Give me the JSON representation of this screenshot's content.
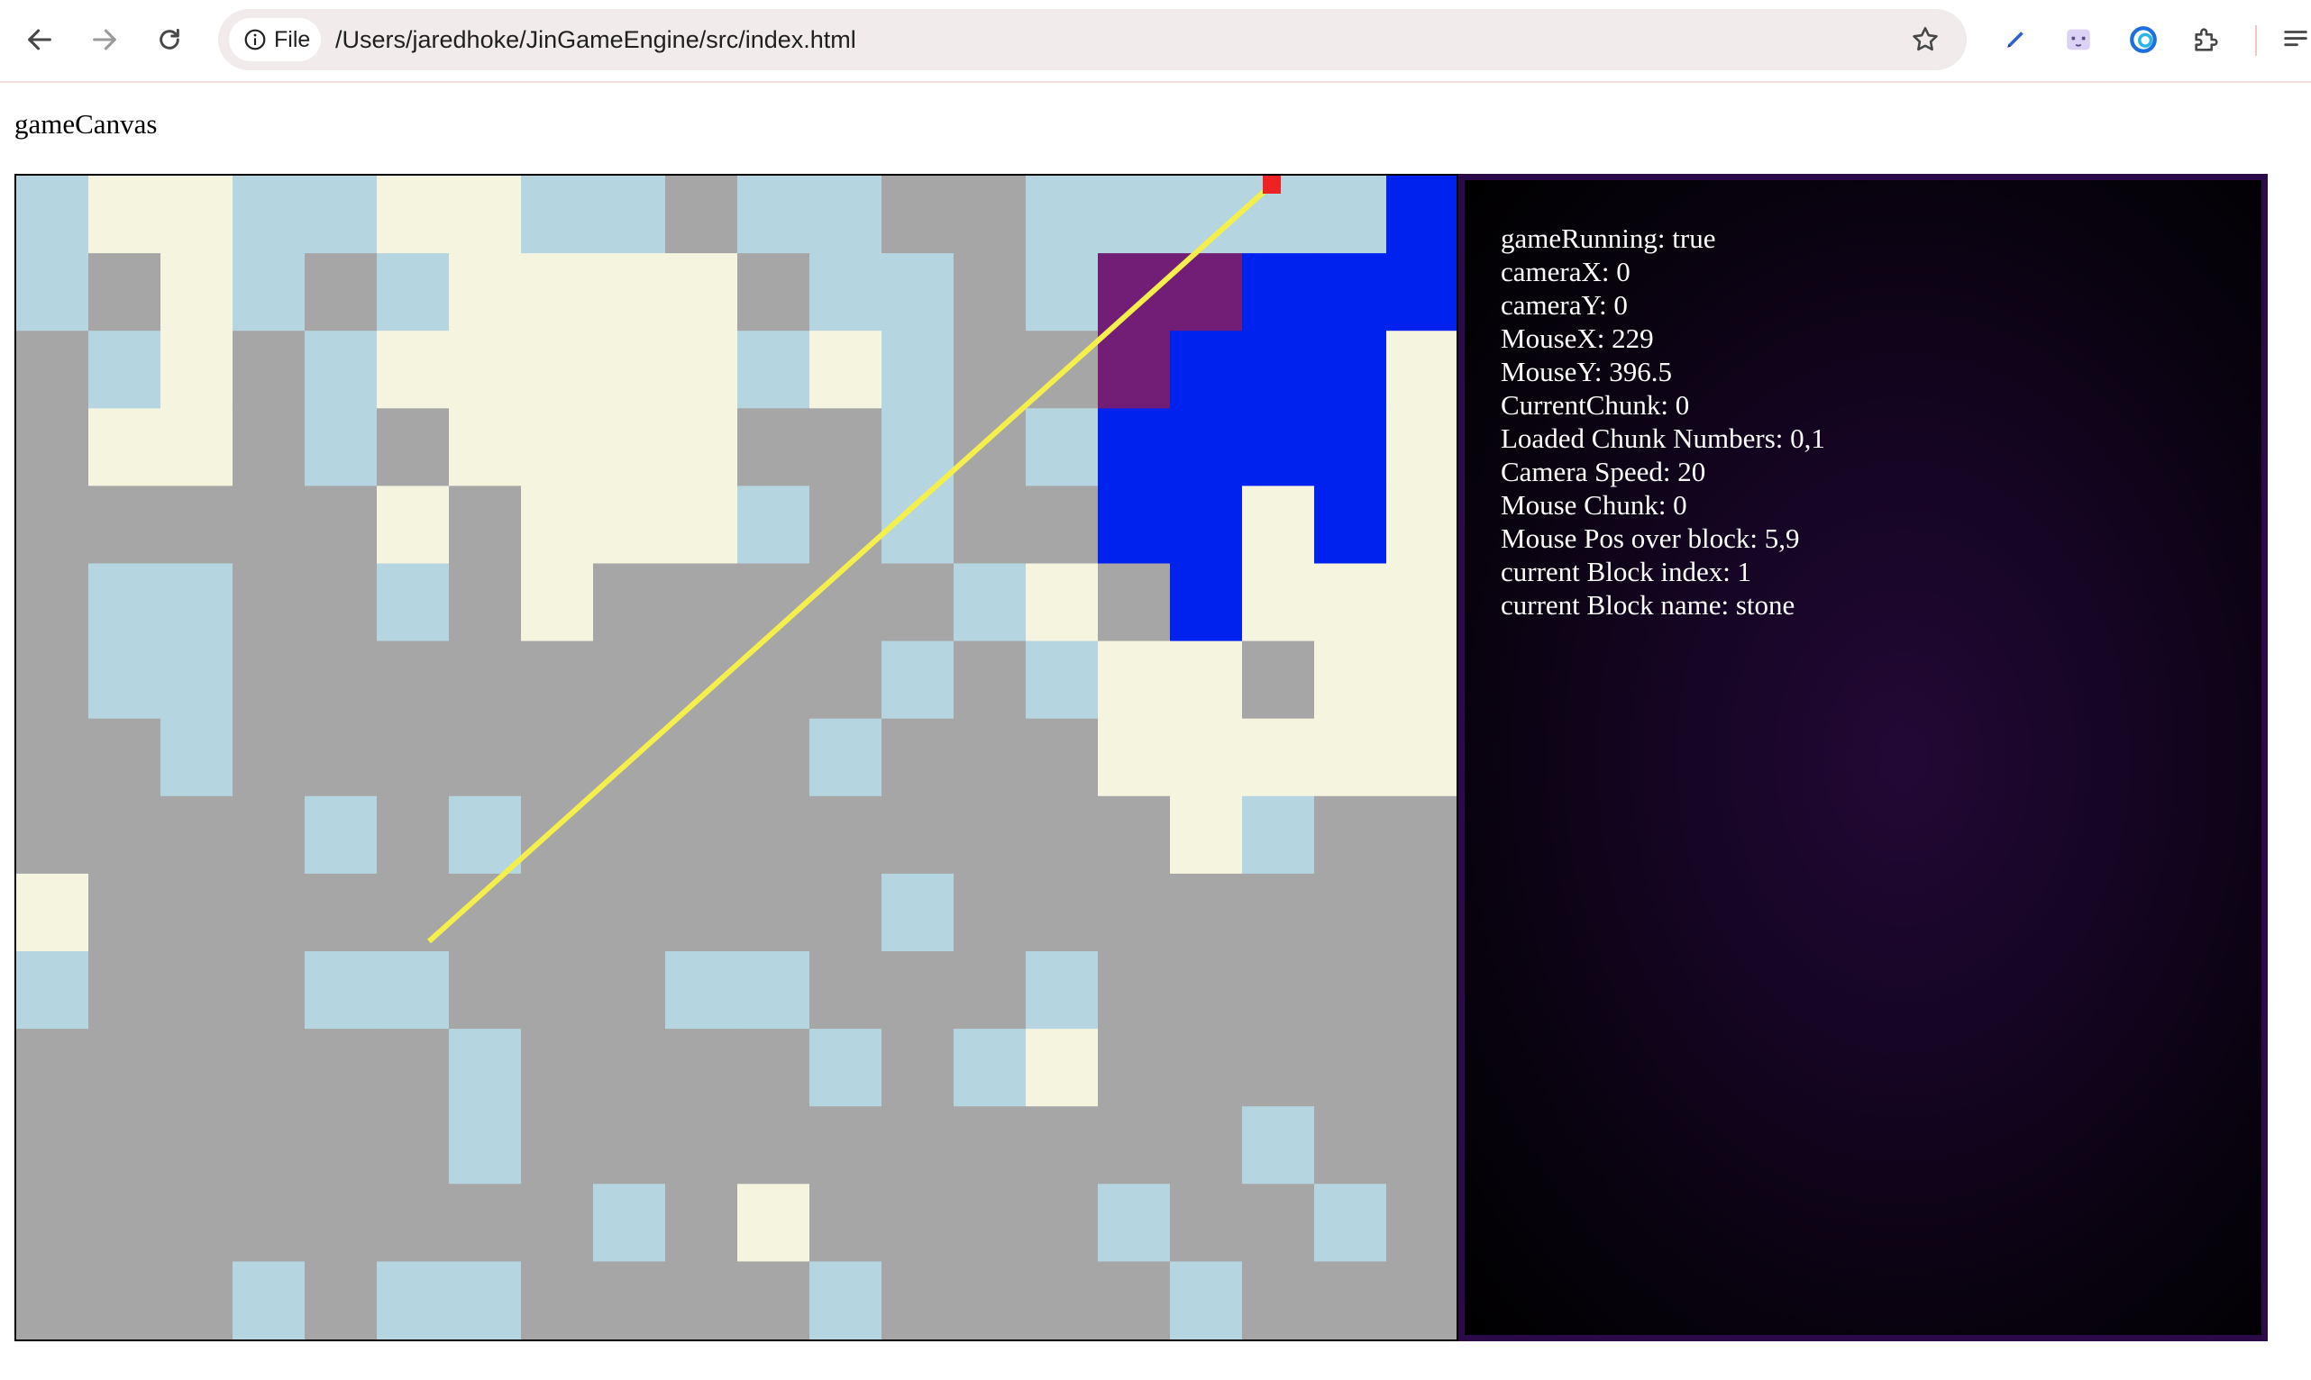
{
  "browser": {
    "scheme_label": "File",
    "url": "/Users/jaredhoke/JinGameEngine/src/index.html",
    "icons": [
      "back-arrow-icon",
      "forward-arrow-icon",
      "reload-icon",
      "info-icon",
      "bookmark-star-icon",
      "pen-extension-icon",
      "cat-extension-icon",
      "edge-copilot-icon",
      "extensions-puzzle-icon",
      "reading-list-icon"
    ]
  },
  "page": {
    "canvas_label": "gameCanvas"
  },
  "game": {
    "colors": {
      "stone": "#a6a6a6",
      "water": "#b5d6e1",
      "sand": "#f5f4df",
      "blue": "#0022ee",
      "purple": "#721e77",
      "ray": "#f4ef4a",
      "marker": "#ee2222"
    },
    "grid": [
      "WSSWWSSWWGWWGGWWWWWBB",
      "WGSWGWSSSSGWWGWPPBBBS",
      "GWSGWSSSSSWSWGGPBBBSB",
      "GSSGWGSSSSGGWGWBBBBSS",
      "GGGGGSGSSSWGWGGBBSBSS",
      "GWWGGWGSGGGGGWSGBSSSS",
      "GWWGGGGGGGGGWGWSSGSSS",
      "GGWGGGGGGGGWGGGSSSSSG",
      "GGGGWGWGGGGGGGGGSWGGW",
      "SGGGGGGGGGGGWGGGGGGGW",
      "WGGGWWGGGWWGGGWGGGGGG",
      "GGGGGGWGGGGWGWSGGGGGG",
      "GGGGGGWGGGGGGGGGGWGGG",
      "GGGGGGGGWGSGGGGWGGWGG",
      "GGGWGWWGGGGWGGGGWGGGG"
    ],
    "ray": {
      "from_mouse": [
        229,
        396.5
      ],
      "target_block": [
        17,
        0
      ]
    }
  },
  "debug": {
    "lines": [
      "gameRunning: true",
      "cameraX: 0",
      "cameraY: 0",
      "MouseX: 229",
      "MouseY: 396.5",
      "CurrentChunk: 0",
      "Loaded Chunk Numbers: 0,1",
      "Camera Speed: 20",
      "Mouse Chunk: 0",
      "Mouse Pos over block: 5,9",
      "current Block index: 1",
      "current Block name: stone"
    ]
  }
}
